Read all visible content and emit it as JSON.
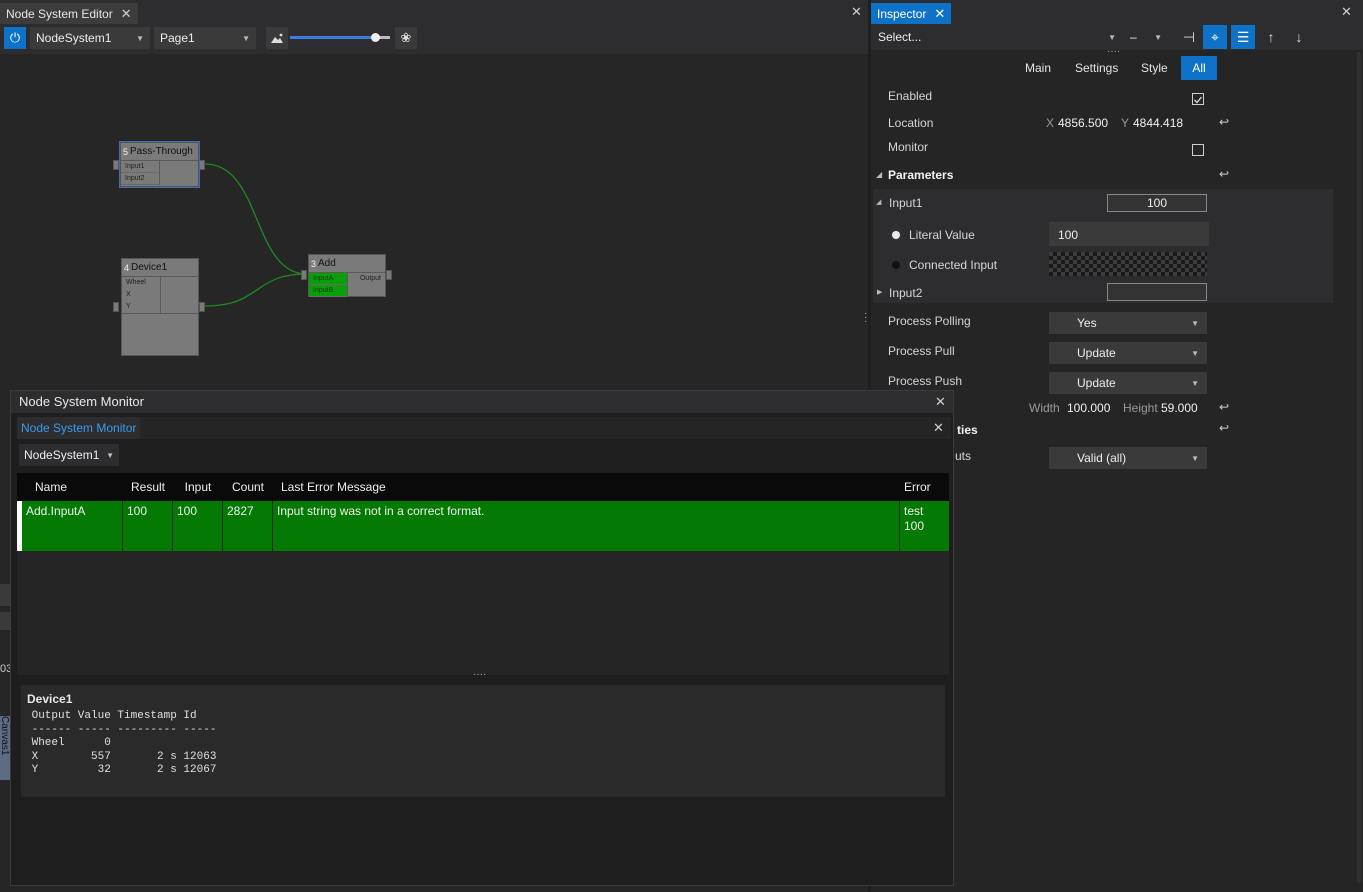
{
  "editor": {
    "tab_title": "Node System Editor",
    "system_select": "NodeSystem1",
    "page_select": "Page1",
    "zoom_percent": 85,
    "nodes": [
      {
        "id": "5",
        "title": "Pass-Through",
        "inputs": [
          "Input1",
          "Input2"
        ],
        "outputs": []
      },
      {
        "id": "4",
        "title": "Device1",
        "inputs": [
          "Wheel",
          "X",
          "Y"
        ],
        "outputs": []
      },
      {
        "id": "3",
        "title": "Add",
        "inputs": [
          "InputA",
          "InputB"
        ],
        "outputs": [
          "Output"
        ]
      }
    ],
    "side_labels": {
      "partial_num": "03",
      "canvas": "Canvas1"
    }
  },
  "inspector": {
    "tab_title": "Inspector",
    "select_placeholder": "Select...",
    "minus_combo": "–",
    "subtabs": [
      "Main",
      "Settings",
      "Style",
      "All"
    ],
    "active_subtab": "All",
    "enabled_label": "Enabled",
    "enabled_checked": true,
    "location_label": "Location",
    "loc_x_label": "X",
    "loc_x": "4856.500",
    "loc_y_label": "Y",
    "loc_y": "4844.418",
    "monitor_label": "Monitor",
    "monitor_checked": false,
    "parameters_label": "Parameters",
    "input1_label": "Input1",
    "input1_value": "100",
    "literal_value_label": "Literal Value",
    "literal_value": "100",
    "connected_input_label": "Connected Input",
    "input2_label": "Input2",
    "input2_value": "",
    "process_polling_label": "Process Polling",
    "process_polling": "Yes",
    "process_pull_label": "Process Pull",
    "process_pull": "Update",
    "process_push_label": "Process Push",
    "process_push": "Update",
    "width_label": "Width",
    "width_value": "100.000",
    "height_label": "Height",
    "height_value": "59.000",
    "properties_partial": "ties",
    "outputs_partial": "uts",
    "outputs_value": "Valid (all)",
    "return_glyph": "↩"
  },
  "monitor": {
    "window_title": "Node System Monitor",
    "tab_title": "Node System Monitor",
    "system_select": "NodeSystem1",
    "columns": [
      "Name",
      "Result",
      "Input",
      "Count",
      "Last Error Message",
      "Error"
    ],
    "rows": [
      {
        "name": "Add.InputA",
        "result": "100",
        "input": "100",
        "count": "2827",
        "message": "Input string was not in a correct format.",
        "error_line1": "test",
        "error_line2": "100"
      }
    ],
    "detail_title": "Device1",
    "detail_text": " Output Value Timestamp Id\n ------ ----- --------- -----\n Wheel      0\n X        557       2 s 12063\n Y         32       2 s 12067"
  },
  "colors": {
    "accent": "#0e72c9",
    "row_green": "#047904",
    "port_green": "#0a9e0a",
    "wire_green": "#1f8a1f"
  }
}
